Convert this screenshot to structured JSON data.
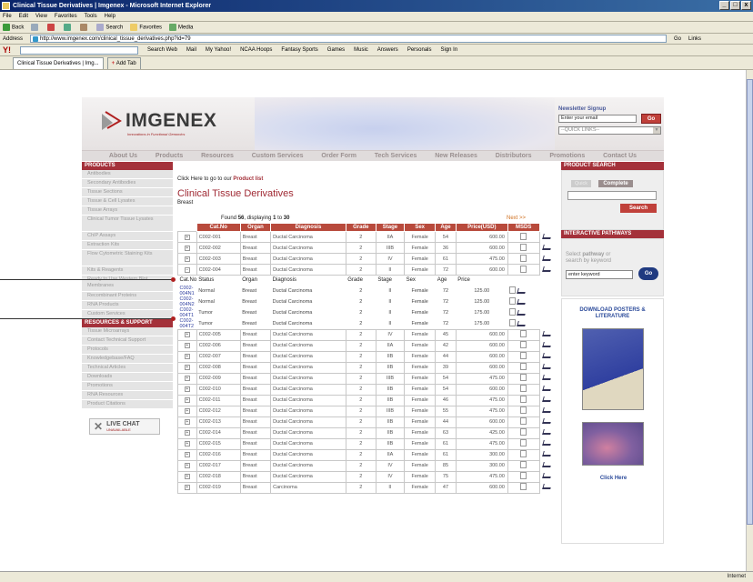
{
  "window": {
    "title": "Clinical Tissue Derivatives | Imgenex - Microsoft Internet Explorer"
  },
  "menu": [
    "File",
    "Edit",
    "View",
    "Favorites",
    "Tools",
    "Help"
  ],
  "toolbar": [
    "Back",
    "Search",
    "Favorites",
    "Media"
  ],
  "address": {
    "label": "Address",
    "url": "http://www.imgenex.com/clinical_tissue_derivatives.php?id=79",
    "go": "Go",
    "links": "Links"
  },
  "yahoo": [
    "Search Web",
    "Mail",
    "My Yahoo!",
    "NCAA Hoops",
    "Fantasy Sports",
    "Games",
    "Music",
    "Answers",
    "Personals",
    "Sign In"
  ],
  "tabs": {
    "active": "Clinical Tissue Derivatives | Img...",
    "add": "Add Tab"
  },
  "status": {
    "zone": "Internet"
  },
  "site": {
    "logo": "IMGENEX",
    "tagline": "Innovations in Functional Genomics",
    "newsletter": {
      "label": "Newsletter Signup",
      "placeholder": "Enter your email",
      "go": "Go",
      "quick": "--QUICK LINKS--"
    },
    "nav": [
      "About Us",
      "Products",
      "Resources",
      "Custom Services",
      "Order Form",
      "Tech Services",
      "New Releases",
      "Distributors",
      "Promotions",
      "Contact Us"
    ]
  },
  "left": {
    "products_head": "PRODUCTS",
    "products": [
      "Antibodies",
      "Secondary Antibodies",
      "Tissue Sections",
      "Tissue & Cell Lysates",
      "Tissue Arrays",
      "Clinical Tumor Tissue Lysates",
      "ChIP Assays",
      "Extraction Kits",
      "Flow Cytometric Staining Kits",
      "Kits & Reagents",
      "Ready to Use Western Blot Membranes",
      "Recombinant Proteins",
      "RNA Products",
      "Custom Services"
    ],
    "resources_head": "RESOURCES & SUPPORT",
    "resources": [
      "Tissue Microarrays",
      "Contact Technical Support",
      "Protocols",
      "Knowledgebase/FAQ",
      "Technical Articles",
      "Downloads",
      "Promotions",
      "RNA Resources",
      "Product Citations"
    ],
    "livechat": "LIVE CHAT",
    "livechat_sub": "UNAVAILABLE"
  },
  "main": {
    "crumb_pre": "Click Here to go to our",
    "crumb_link": "Product list",
    "title": "Clinical Tissue Derivatives",
    "subtitle": "Breast",
    "found_pre": "Found",
    "found_n": "56",
    "found_mid": ", displaying",
    "found_from": "1",
    "found_to_word": "to",
    "found_to": "30",
    "next": "Next >>",
    "headers": [
      "Cat.No",
      "Organ",
      "Diagnosis",
      "Grade",
      "Stage",
      "Sex",
      "Age",
      "Price(USD)",
      "MSDS"
    ],
    "rows_top": [
      [
        "C002-001",
        "Breast",
        "Ductal Carcinoma",
        "2",
        "IIA",
        "Female",
        "54",
        "600.00"
      ],
      [
        "C002-002",
        "Breast",
        "Ductal Carcinoma",
        "2",
        "IIIB",
        "Female",
        "36",
        "600.00"
      ],
      [
        "C002-003",
        "Breast",
        "Ductal Carcinoma",
        "2",
        "IV",
        "Female",
        "61",
        "475.00"
      ],
      [
        "C002-004",
        "Breast",
        "Ductal Carcinoma",
        "2",
        "II",
        "Female",
        "72",
        "600.00"
      ]
    ],
    "sub_headers": [
      "Cat.No",
      "Status",
      "Organ",
      "Diagnosis",
      "Grade",
      "Stage",
      "Sex",
      "Age",
      "Price"
    ],
    "sub_rows": [
      [
        "C002-004N1",
        "Normal",
        "Breast",
        "Ductal Carcinoma",
        "2",
        "II",
        "Female",
        "72",
        "125.00"
      ],
      [
        "C002-004N2",
        "Normal",
        "Breast",
        "Ductal Carcinoma",
        "2",
        "II",
        "Female",
        "72",
        "125.00"
      ],
      [
        "C002-004T1",
        "Tumor",
        "Breast",
        "Ductal Carcinoma",
        "2",
        "II",
        "Female",
        "72",
        "175.00"
      ],
      [
        "C002-004T2",
        "Tumor",
        "Breast",
        "Ductal Carcinoma",
        "2",
        "II",
        "Female",
        "72",
        "175.00"
      ]
    ],
    "rows_bottom": [
      [
        "C002-005",
        "Breast",
        "Ductal Carcinoma",
        "2",
        "IV",
        "Female",
        "45",
        "600.00"
      ],
      [
        "C002-006",
        "Breast",
        "Ductal Carcinoma",
        "2",
        "IIA",
        "Female",
        "42",
        "600.00"
      ],
      [
        "C002-007",
        "Breast",
        "Ductal Carcinoma",
        "2",
        "IIB",
        "Female",
        "44",
        "600.00"
      ],
      [
        "C002-008",
        "Breast",
        "Ductal Carcinoma",
        "2",
        "IIB",
        "Female",
        "39",
        "600.00"
      ],
      [
        "C002-009",
        "Breast",
        "Ductal Carcinoma",
        "2",
        "IIIB",
        "Female",
        "54",
        "475.00"
      ],
      [
        "C002-010",
        "Breast",
        "Ductal Carcinoma",
        "2",
        "IIB",
        "Female",
        "54",
        "600.00"
      ],
      [
        "C002-011",
        "Breast",
        "Ductal Carcinoma",
        "2",
        "IIB",
        "Female",
        "46",
        "475.00"
      ],
      [
        "C002-012",
        "Breast",
        "Ductal Carcinoma",
        "2",
        "IIIB",
        "Female",
        "55",
        "475.00"
      ],
      [
        "C002-013",
        "Breast",
        "Ductal Carcinoma",
        "2",
        "IIB",
        "Female",
        "44",
        "600.00"
      ],
      [
        "C002-014",
        "Breast",
        "Ductal Carcinoma",
        "2",
        "IIB",
        "Female",
        "63",
        "425.00"
      ],
      [
        "C002-015",
        "Breast",
        "Ductal Carcinoma",
        "2",
        "IIB",
        "Female",
        "61",
        "475.00"
      ],
      [
        "C002-016",
        "Breast",
        "Ductal Carcinoma",
        "2",
        "IIA",
        "Female",
        "61",
        "300.00"
      ],
      [
        "C002-017",
        "Breast",
        "Ductal Carcinoma",
        "2",
        "IV",
        "Female",
        "85",
        "300.00"
      ],
      [
        "C002-018",
        "Breast",
        "Ductal Carcinoma",
        "2",
        "IV",
        "Female",
        "75",
        "475.00"
      ],
      [
        "C002-019",
        "Breast",
        "Carcinoma",
        "2",
        "II",
        "Female",
        "47",
        "600.00"
      ]
    ]
  },
  "right": {
    "search_head": "PRODUCT SEARCH",
    "quick": "Quick",
    "complete": "Complete",
    "search_btn": "Search",
    "paths_head": "INTERACTIVE PATHWAYS",
    "paths_text1": "Select",
    "paths_text_b": "pathway",
    "paths_text2": "or",
    "paths_text3": "search by keyword",
    "kw_placeholder": "enter keyword",
    "kw_go": "Go",
    "dl_title": "DOWNLOAD POSTERS & LITERATURE",
    "click": "Click Here"
  }
}
